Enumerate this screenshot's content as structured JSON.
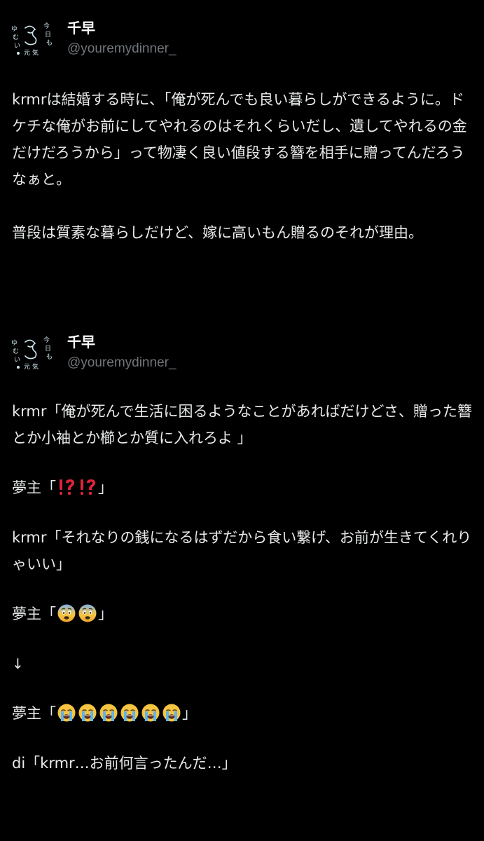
{
  "tweets": [
    {
      "author": {
        "name": "千早",
        "handle": "@youremydinner_",
        "avatar_text": [
          "ゆ",
          "む",
          "い",
          "今",
          "日",
          "も",
          "元",
          "気"
        ]
      },
      "paragraphs": [
        "krmrは結婚する時に、「俺が死んでも良い暮らしができるように。ドケチな俺がお前にしてやれるのはそれくらいだし、遺してやれるの金だけだろうから」って物凄く良い値段する簪を相手に贈ってんだろうなぁと。",
        "普段は質素な暮らしだけど、嫁に高いもん贈るのそれが理由。"
      ]
    },
    {
      "author": {
        "name": "千早",
        "handle": "@youremydinner_",
        "avatar_text": [
          "ゆ",
          "む",
          "い",
          "今",
          "日",
          "も",
          "元",
          "気"
        ]
      },
      "lines": {
        "l1": "krmr「俺が死んで生活に困るようなことがあればだけどさ、贈った簪とか小袖とか櫛とか質に入れろよ 」",
        "l2_prefix": "夢主「",
        "l2_suffix": "」",
        "l3": "krmr「それなりの銭になるはずだから食い繋げ、お前が生きてくれりゃいい」",
        "l4_prefix": "夢主「",
        "l4_suffix": "」",
        "l5": "↓",
        "l6_prefix": "夢主「",
        "l6_suffix": "」",
        "l7": "di「krmr…お前何言ったんだ…」"
      },
      "emoji": {
        "l2": [
          "interrobang-icon",
          "interrobang-icon"
        ],
        "l4": [
          "fearful-face-icon",
          "fearful-face-icon"
        ],
        "l6": [
          "loudly-crying-face-icon",
          "loudly-crying-face-icon",
          "loudly-crying-face-icon",
          "loudly-crying-face-icon",
          "loudly-crying-face-icon",
          "loudly-crying-face-icon"
        ]
      }
    }
  ],
  "colors": {
    "background": "#000000",
    "text": "#e7e9ea",
    "handle": "#71767b",
    "interrobang": "#e0243a"
  }
}
